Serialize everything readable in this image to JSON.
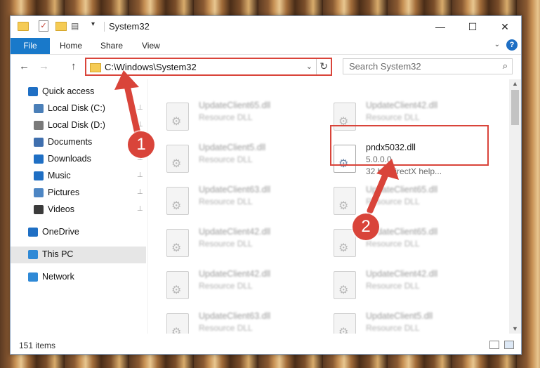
{
  "window": {
    "title": "System32",
    "minimize_glyph": "—",
    "maximize_glyph": "☐",
    "close_glyph": "✕"
  },
  "ribbon": {
    "tabs": [
      "File",
      "Home",
      "Share",
      "View"
    ],
    "help_glyph": "?",
    "collapse_glyph": "⌄"
  },
  "nav": {
    "back_glyph": "←",
    "forward_glyph": "→",
    "up_glyph": "↑",
    "address": "C:\\Windows\\System32",
    "address_dropdown_glyph": "⌄",
    "refresh_glyph": "↻",
    "search_placeholder": "Search System32",
    "search_glyph": "⌕"
  },
  "sidebar": {
    "items": [
      {
        "label": "Quick access",
        "icon": "star-icon",
        "color": "#1f6fc4",
        "pinned": false
      },
      {
        "label": "Local Disk (C:)",
        "icon": "drive-icon",
        "color": "#4a7fb8",
        "pinned": true
      },
      {
        "label": "Local Disk (D:)",
        "icon": "drive-icon",
        "color": "#7a7a7a",
        "pinned": true
      },
      {
        "label": "Documents",
        "icon": "documents-icon",
        "color": "#3f6fae",
        "pinned": true
      },
      {
        "label": "Downloads",
        "icon": "downloads-icon",
        "color": "#1f6fc4",
        "pinned": true
      },
      {
        "label": "Music",
        "icon": "music-icon",
        "color": "#1f6fc4",
        "pinned": true
      },
      {
        "label": "Pictures",
        "icon": "pictures-icon",
        "color": "#4d86c4",
        "pinned": true
      },
      {
        "label": "Videos",
        "icon": "videos-icon",
        "color": "#3b3b3b",
        "pinned": true
      },
      {
        "label": "OneDrive",
        "icon": "onedrive-icon",
        "color": "#1f6fc4",
        "pinned": false
      },
      {
        "label": "This PC",
        "icon": "computer-icon",
        "color": "#2f89d6",
        "pinned": false
      },
      {
        "label": "Network",
        "icon": "network-icon",
        "color": "#2f89d6",
        "pinned": false
      }
    ],
    "pin_glyph": "📌"
  },
  "files": [
    {
      "name": "UpdateClient65.dll",
      "sub": "Resource DLL",
      "col": 0,
      "row": 0
    },
    {
      "name": "UpdateClient42.dll",
      "sub": "Resource DLL",
      "col": 1,
      "row": 0
    },
    {
      "name": "UpdateClient5.dll",
      "sub": "Resource DLL",
      "col": 0,
      "row": 1
    },
    {
      "name": "pndx5032.dll",
      "sub": "5.0.0.0",
      "sub2": "32 bit DirectX help...",
      "col": 1,
      "row": 1,
      "highlighted": true
    },
    {
      "name": "UpdateClient63.dll",
      "sub": "Resource DLL",
      "col": 0,
      "row": 2
    },
    {
      "name": "UpdateClient65.dll",
      "sub": "Resource DLL",
      "col": 1,
      "row": 2
    },
    {
      "name": "UpdateClient42.dll",
      "sub": "Resource DLL",
      "col": 0,
      "row": 3
    },
    {
      "name": "UpdateClient65.dll",
      "sub": "Resource DLL",
      "col": 1,
      "row": 3
    },
    {
      "name": "UpdateClient42.dll",
      "sub": "Resource DLL",
      "col": 0,
      "row": 4
    },
    {
      "name": "UpdateClient42.dll",
      "sub": "Resource DLL",
      "col": 1,
      "row": 4
    },
    {
      "name": "UpdateClient63.dll",
      "sub": "Resource DLL",
      "col": 0,
      "row": 5
    },
    {
      "name": "UpdateClient5.dll",
      "sub": "Resource DLL",
      "col": 1,
      "row": 5
    }
  ],
  "status": {
    "item_count": "151 items"
  },
  "annotations": {
    "callout1": "1",
    "callout2": "2",
    "accent": "#d9443a"
  }
}
